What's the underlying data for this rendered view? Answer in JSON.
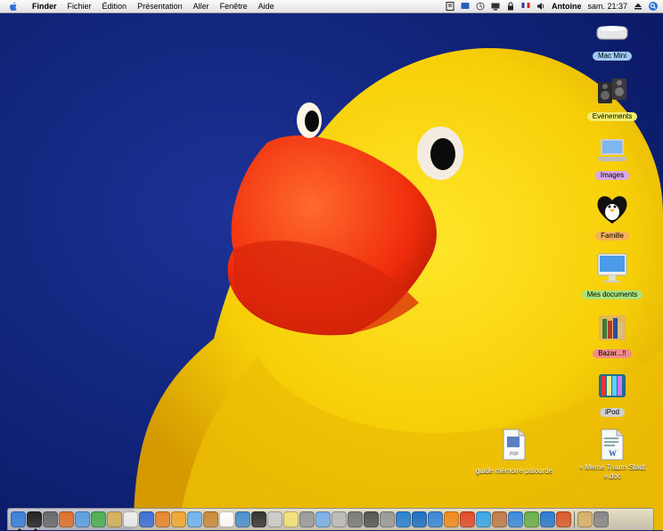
{
  "menubar": {
    "apple_icon": "apple-icon",
    "items": [
      "Finder",
      "Fichier",
      "Édition",
      "Présentation",
      "Aller",
      "Fenêtre",
      "Aide"
    ],
    "extras": [
      "script-icon",
      "display-icon",
      "timemachine-icon",
      "monitor-icon",
      "lock-icon",
      "flag-icon",
      "volume-icon"
    ],
    "user": "Antoine",
    "clock": "sam. 21:37",
    "eject_icon": "eject-icon",
    "spotlight_icon": "spotlight-icon"
  },
  "desktop": {
    "wallpaper": "yellow-rubber-duck-on-blue",
    "icons": [
      {
        "label": "Mac Mini",
        "icon": "mac-mini-icon",
        "label_color": "#9ec9f5"
      },
      {
        "label": "Evénements",
        "icon": "speakers-icon",
        "label_color": "#f2ee6d"
      },
      {
        "label": "Images",
        "icon": "laptop-icon",
        "label_color": "#d9a6e8"
      },
      {
        "label": "Famille",
        "icon": "penguin-heart-icon",
        "label_color": "#f6b25a"
      },
      {
        "label": "Mes documents",
        "icon": "imac-icon",
        "label_color": "#a9e37b"
      },
      {
        "label": "Bazar...!!",
        "icon": "books-icon",
        "label_color": "#f28b8b"
      },
      {
        "label": "iPod",
        "icon": "ipod-icon",
        "label_color": "#d0d0d0"
      },
      {
        "label": "guide mémoire palourde",
        "icon": "pdf-file-icon",
        "label_color": ""
      },
      {
        "label": "« Meine Traum Stadt ».doc",
        "icon": "word-doc-icon",
        "label_color": ""
      }
    ]
  },
  "dock": {
    "items": [
      {
        "name": "finder",
        "color": "#3a7fd8",
        "running": true
      },
      {
        "name": "dashboard",
        "color": "#222222",
        "running": true
      },
      {
        "name": "itunes-screen",
        "color": "#6a6a6a",
        "running": false
      },
      {
        "name": "firefox",
        "color": "#e0702a",
        "running": false
      },
      {
        "name": "safari",
        "color": "#5aa0e0",
        "running": false
      },
      {
        "name": "adium",
        "color": "#4caf50",
        "running": false
      },
      {
        "name": "notes",
        "color": "#d8b25a",
        "running": false
      },
      {
        "name": "textedit",
        "color": "#eeeeee",
        "running": false
      },
      {
        "name": "word",
        "color": "#3b6fd6",
        "running": false
      },
      {
        "name": "powerpoint",
        "color": "#e5862b",
        "running": false
      },
      {
        "name": "pages",
        "color": "#f0a830",
        "running": false
      },
      {
        "name": "itunes",
        "color": "#6fb4ee",
        "running": false
      },
      {
        "name": "garageband",
        "color": "#c88a3a",
        "running": false
      },
      {
        "name": "ical",
        "color": "#ffffff",
        "running": false
      },
      {
        "name": "network",
        "color": "#4a90d0",
        "running": false
      },
      {
        "name": "photo-booth",
        "color": "#333333",
        "running": false
      },
      {
        "name": "preview",
        "color": "#cccccc",
        "running": false
      },
      {
        "name": "stickies",
        "color": "#f4e27a",
        "running": false
      },
      {
        "name": "calculator",
        "color": "#9a9a9a",
        "running": false
      },
      {
        "name": "ichat",
        "color": "#7ab0e8",
        "running": false
      },
      {
        "name": "mail-stamp",
        "color": "#bbbbbb",
        "running": false
      },
      {
        "name": "system-prefs",
        "color": "#7a7a7a",
        "running": false
      },
      {
        "name": "printer",
        "color": "#555555",
        "running": false
      },
      {
        "name": "address-book",
        "color": "#999999",
        "running": false
      },
      {
        "name": "sync",
        "color": "#2a7fd0",
        "running": false
      },
      {
        "name": "safari-2",
        "color": "#1c6fc4",
        "running": false
      },
      {
        "name": "keynote",
        "color": "#3a87d8",
        "running": false
      },
      {
        "name": "vlc",
        "color": "#f08a1a",
        "running": false
      },
      {
        "name": "transmit",
        "color": "#e04a2a",
        "running": false
      },
      {
        "name": "skype",
        "color": "#3aa6e8",
        "running": false
      },
      {
        "name": "pictures",
        "color": "#c07a4a",
        "running": false
      },
      {
        "name": "iweb",
        "color": "#3a8ae0",
        "running": false
      },
      {
        "name": "graphic",
        "color": "#6ab04a",
        "running": false
      },
      {
        "name": "script",
        "color": "#2a7ad0",
        "running": false
      },
      {
        "name": "flashcards",
        "color": "#d85a2a",
        "running": false
      },
      {
        "name": "sep",
        "color": "",
        "running": false
      },
      {
        "name": "home-folder",
        "color": "#d8b06a",
        "running": false
      },
      {
        "name": "trash",
        "color": "#888888",
        "running": false
      }
    ]
  }
}
